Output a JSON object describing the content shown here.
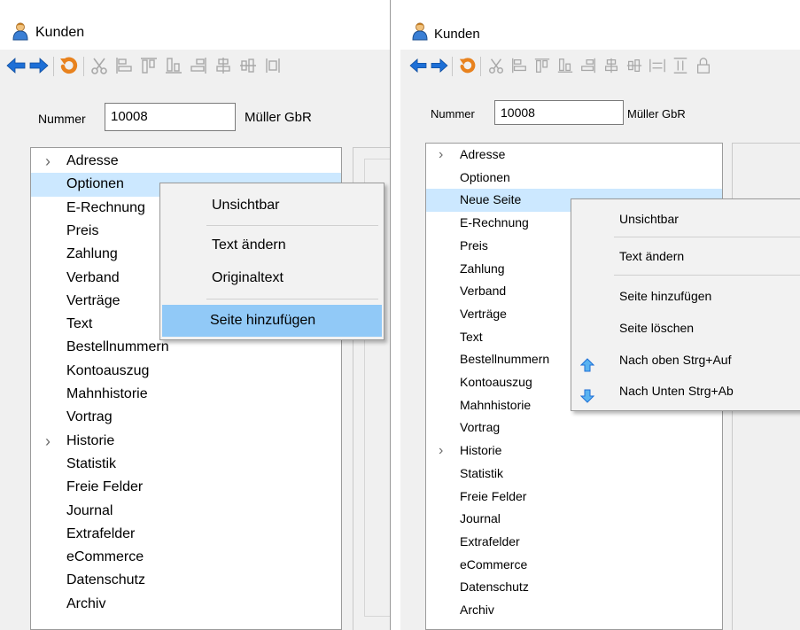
{
  "left": {
    "title": "Kunden",
    "nummer_label": "Nummer",
    "nummer_value": "10008",
    "customer_name": "Müller GbR",
    "tree": [
      {
        "label": "Adresse",
        "expandable": true
      },
      {
        "label": "Optionen",
        "selected": true
      },
      {
        "label": "E-Rechnung"
      },
      {
        "label": "Preis"
      },
      {
        "label": "Zahlung"
      },
      {
        "label": "Verband"
      },
      {
        "label": "Verträge"
      },
      {
        "label": "Text"
      },
      {
        "label": "Bestellnummern"
      },
      {
        "label": "Kontoauszug"
      },
      {
        "label": "Mahnhistorie"
      },
      {
        "label": "Vortrag"
      },
      {
        "label": "Historie",
        "expandable": true
      },
      {
        "label": "Statistik"
      },
      {
        "label": "Freie Felder"
      },
      {
        "label": "Journal"
      },
      {
        "label": "Extrafelder"
      },
      {
        "label": "eCommerce"
      },
      {
        "label": "Datenschutz"
      },
      {
        "label": "Archiv"
      }
    ],
    "context_menu": {
      "unsichtbar": "Unsichtbar",
      "text_aendern": "Text ändern",
      "originaltext": "Originaltext",
      "seite_hinzufuegen": "Seite hinzufügen"
    }
  },
  "right": {
    "title": "Kunden",
    "nummer_label": "Nummer",
    "nummer_value": "10008",
    "customer_name": "Müller GbR",
    "tree": [
      {
        "label": "Adresse",
        "expandable": true
      },
      {
        "label": "Optionen"
      },
      {
        "label": "Neue Seite",
        "selected": true
      },
      {
        "label": "E-Rechnung"
      },
      {
        "label": "Preis"
      },
      {
        "label": "Zahlung"
      },
      {
        "label": "Verband"
      },
      {
        "label": "Verträge"
      },
      {
        "label": "Text"
      },
      {
        "label": "Bestellnummern"
      },
      {
        "label": "Kontoauszug"
      },
      {
        "label": "Mahnhistorie"
      },
      {
        "label": "Vortrag"
      },
      {
        "label": "Historie",
        "expandable": true
      },
      {
        "label": "Statistik"
      },
      {
        "label": "Freie Felder"
      },
      {
        "label": "Journal"
      },
      {
        "label": "Extrafelder"
      },
      {
        "label": "eCommerce"
      },
      {
        "label": "Datenschutz"
      },
      {
        "label": "Archiv"
      }
    ],
    "context_menu": {
      "unsichtbar": "Unsichtbar",
      "text_aendern": "Text ändern",
      "seite_hinzufuegen": "Seite hinzufügen",
      "seite_loeschen": "Seite löschen",
      "nach_oben": "Nach oben Strg+Auf",
      "nach_unten": "Nach Unten Strg+Ab"
    }
  },
  "icons": {
    "app": "customers-people-icon",
    "back": "arrow-left-icon",
    "forward": "arrow-right-icon",
    "undo": "undo-icon",
    "cut": "scissors-icon",
    "move_up": "arrow-up-icon",
    "move_down": "arrow-down-icon"
  },
  "colors": {
    "selection": "#cce8ff",
    "menu_highlight": "#91c9f7",
    "arrow_blue": "#1d6fd6",
    "undo_orange": "#e8821e"
  }
}
